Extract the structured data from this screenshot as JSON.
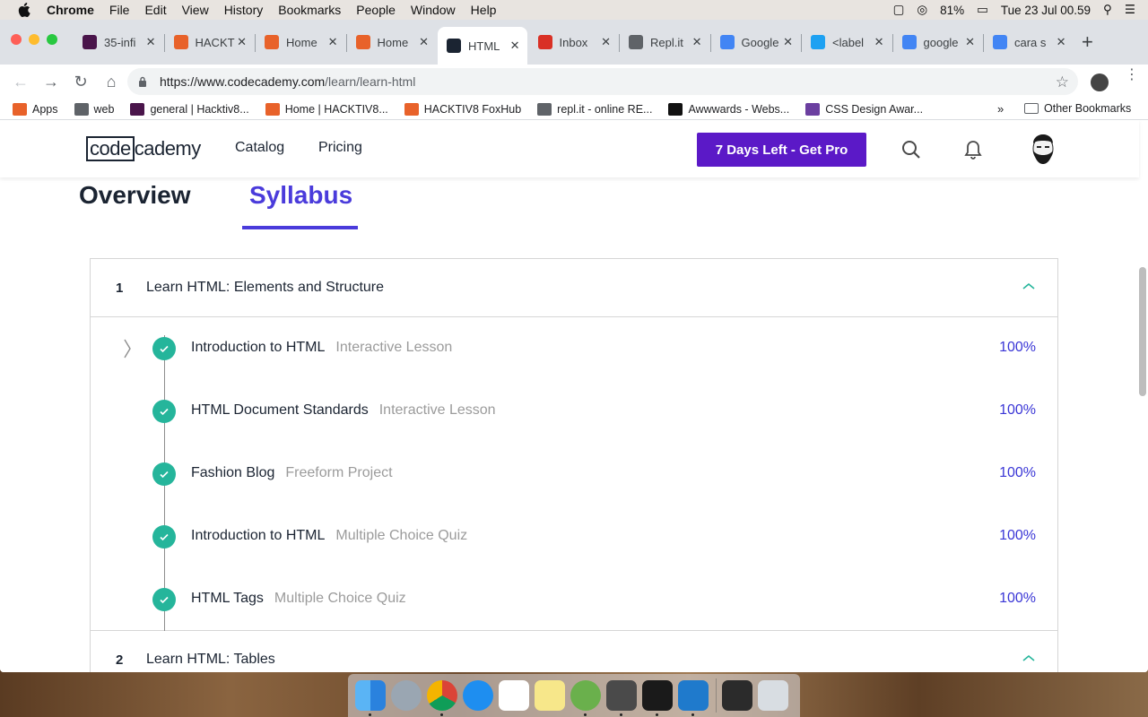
{
  "menubar": {
    "app": "Chrome",
    "items": [
      "File",
      "Edit",
      "View",
      "History",
      "Bookmarks",
      "People",
      "Window",
      "Help"
    ],
    "battery": "81%",
    "clock": "Tue 23 Jul  00.59"
  },
  "tabs": [
    {
      "label": "35-infi",
      "color": "#4a154b"
    },
    {
      "label": "HACKT",
      "color": "#e8622a"
    },
    {
      "label": "Home",
      "color": "#e8622a"
    },
    {
      "label": "Home",
      "color": "#e8622a"
    },
    {
      "label": "HTML",
      "color": "#1b2432",
      "active": true
    },
    {
      "label": "Inbox",
      "color": "#d93025"
    },
    {
      "label": "Repl.it",
      "color": "#5f6368"
    },
    {
      "label": "Google",
      "color": "#4285f4"
    },
    {
      "label": "<label",
      "color": "#1da1f2"
    },
    {
      "label": "google",
      "color": "#4285f4"
    },
    {
      "label": "cara s",
      "color": "#4285f4"
    }
  ],
  "omnibox": {
    "host": "https://www.codecademy.com",
    "path": "/learn/learn-html"
  },
  "bookmarks": [
    {
      "label": "Apps",
      "icon": "apps-grid-icon",
      "color": "#e8622a"
    },
    {
      "label": "web",
      "icon": "folder-icon",
      "color": "#5f6368"
    },
    {
      "label": "general | Hacktiv8...",
      "icon": "slack-icon",
      "color": "#4a154b"
    },
    {
      "label": "Home | HACKTIV8...",
      "icon": "fox-icon",
      "color": "#e8622a"
    },
    {
      "label": "HACKTIV8 FoxHub",
      "icon": "fox-icon",
      "color": "#e8622a"
    },
    {
      "label": "repl.it - online RE...",
      "icon": "replit-icon",
      "color": "#5f6368"
    },
    {
      "label": "Awwwards - Webs...",
      "icon": "awwwards-icon",
      "color": "#111"
    },
    {
      "label": "CSS Design Awar...",
      "icon": "cssda-icon",
      "color": "#6b3fa0"
    }
  ],
  "bookmarks_more": "»",
  "bookmarks_other": "Other Bookmarks",
  "header": {
    "logo_left": "code",
    "logo_right": "cademy",
    "nav": [
      "Catalog",
      "Pricing"
    ],
    "cta": "7 Days Left - Get Pro"
  },
  "page_tabs": {
    "overview": "Overview",
    "syllabus": "Syllabus"
  },
  "modules": [
    {
      "number": "1",
      "title": "Learn HTML: Elements and Structure",
      "lessons": [
        {
          "title": "Introduction to HTML",
          "type": "Interactive Lesson",
          "progress": "100%"
        },
        {
          "title": "HTML Document Standards",
          "type": "Interactive Lesson",
          "progress": "100%"
        },
        {
          "title": "Fashion Blog",
          "type": "Freeform Project",
          "progress": "100%"
        },
        {
          "title": "Introduction to HTML",
          "type": "Multiple Choice Quiz",
          "progress": "100%"
        },
        {
          "title": "HTML Tags",
          "type": "Multiple Choice Quiz",
          "progress": "100%"
        }
      ]
    },
    {
      "number": "2",
      "title": "Learn HTML: Tables"
    }
  ],
  "colors": {
    "accent": "#4a3bdb",
    "cta": "#5b19c7",
    "check": "#25b59b",
    "progress": "#3a36d6"
  }
}
